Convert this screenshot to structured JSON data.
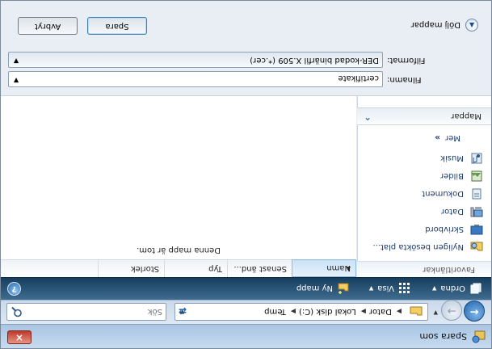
{
  "window": {
    "title": "Spara som",
    "close_label": "×"
  },
  "address": {
    "breadcrumb": [
      "Dator",
      "Lokal disk (C:)",
      "Temp"
    ],
    "search_placeholder": "Sök"
  },
  "toolbar": {
    "organize": "Ordna",
    "views": "Visa",
    "new_folder": "Ny mapp",
    "help": "?"
  },
  "nav": {
    "favorites_header": "Favoritlänkar",
    "items": [
      {
        "label": "Nyligen besökta plat...",
        "icon": "recent-places-icon"
      },
      {
        "label": "Skrivbord",
        "icon": "desktop-icon"
      },
      {
        "label": "Dator",
        "icon": "computer-icon"
      },
      {
        "label": "Dokument",
        "icon": "documents-icon"
      },
      {
        "label": "Bilder",
        "icon": "pictures-icon"
      },
      {
        "label": "Musik",
        "icon": "music-icon"
      }
    ],
    "more": "Mer",
    "more_chevron": "»",
    "folders": "Mappar"
  },
  "columns": [
    "Namn",
    "Senast änd...",
    "Typ",
    "Storlek"
  ],
  "empty_message": "Denna mapp är tom.",
  "fields": {
    "filename_label": "Filnamn:",
    "filename_value": "certifikate",
    "format_label": "Filformat:",
    "format_value": "DER-kodad binärfil X.509 (*.cer)"
  },
  "buttons": {
    "hide_folders": "Dölj mappar",
    "save": "Spara",
    "cancel": "Avbryt"
  },
  "colors": {
    "toolbar_top": "#3f6c90",
    "toolbar_bottom": "#173e5e",
    "link_text": "#1a3a6b",
    "close_red": "#c0392b"
  }
}
